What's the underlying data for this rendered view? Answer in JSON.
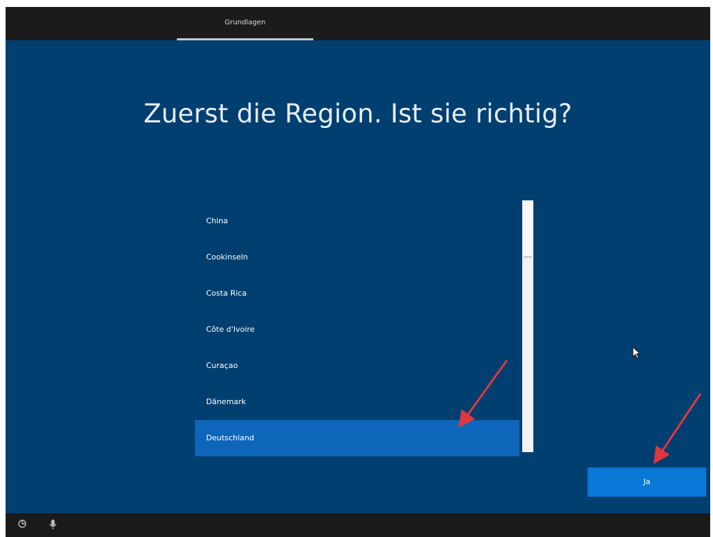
{
  "topbar": {
    "tab_label": "Grundlagen"
  },
  "main": {
    "heading": "Zuerst die Region. Ist sie richtig?"
  },
  "region_list": {
    "items": [
      {
        "label": "China"
      },
      {
        "label": "Cookinseln"
      },
      {
        "label": "Costa Rica"
      },
      {
        "label": "Côte d'Ivoire"
      },
      {
        "label": "Curaçao"
      },
      {
        "label": "Dänemark"
      },
      {
        "label": "Deutschland"
      }
    ],
    "selected": "Deutschland"
  },
  "buttons": {
    "yes_label": "Ja"
  },
  "bottombar": {
    "icons": [
      "ease-of-access-icon",
      "microphone-icon"
    ]
  },
  "colors": {
    "background": "#013f71",
    "selected_row": "#0d66ba",
    "primary_button": "#0a78d7",
    "bar": "#1b1b1b",
    "annotation_arrow": "#e0363f"
  }
}
